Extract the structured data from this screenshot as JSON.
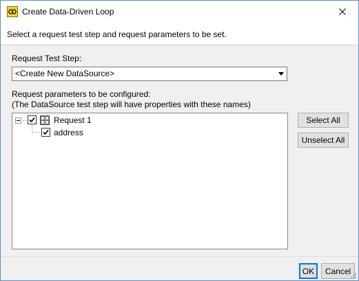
{
  "window": {
    "title": "Create Data-Driven Loop",
    "icon": "app-loop-icon",
    "close_icon": "close-icon"
  },
  "header": {
    "instructions": "Select a request test step and request parameters to be set."
  },
  "request_step": {
    "label": "Request Test Step:",
    "selected_value": "<Create New DataSource>"
  },
  "params": {
    "label_line1": "Request parameters to be configured:",
    "label_line2": "(The DataSource test step will have properties with these names)",
    "tree": [
      {
        "label": "Request 1",
        "checked": true,
        "expanded": true,
        "icon": "request-icon"
      },
      {
        "label": "address",
        "checked": true
      }
    ]
  },
  "side_buttons": {
    "select_all": "Select All",
    "unselect_all": "Unselect All"
  },
  "footer": {
    "ok": "OK",
    "cancel": "Cancel"
  },
  "colors": {
    "focus_border": "#0078d7",
    "window_border": "#5a8fc8",
    "dialog_bg": "#f0f0f0"
  }
}
